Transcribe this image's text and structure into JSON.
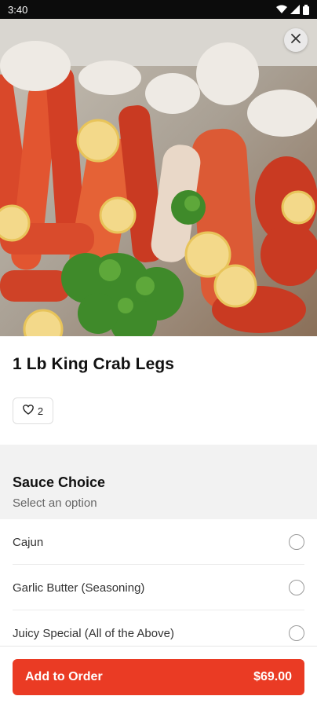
{
  "status_bar": {
    "time": "3:40",
    "icons": [
      "wifi-icon",
      "signal-icon",
      "battery-icon"
    ]
  },
  "hero": {
    "image": "crab-legs-photo",
    "close_icon": "close-icon"
  },
  "item": {
    "title": "1 Lb King Crab Legs",
    "likes": "2",
    "like_icon": "heart-icon"
  },
  "sauce": {
    "title": "Sauce Choice",
    "subtitle": "Select an option",
    "options": [
      {
        "label": "Cajun",
        "selected": false
      },
      {
        "label": "Garlic Butter (Seasoning)",
        "selected": false
      },
      {
        "label": "Juicy Special (All of the Above)",
        "selected": false
      }
    ]
  },
  "order": {
    "label": "Add to Order",
    "price": "$69.00"
  },
  "colors": {
    "accent": "#ea3b24",
    "section_bg": "#f2f2f2"
  }
}
